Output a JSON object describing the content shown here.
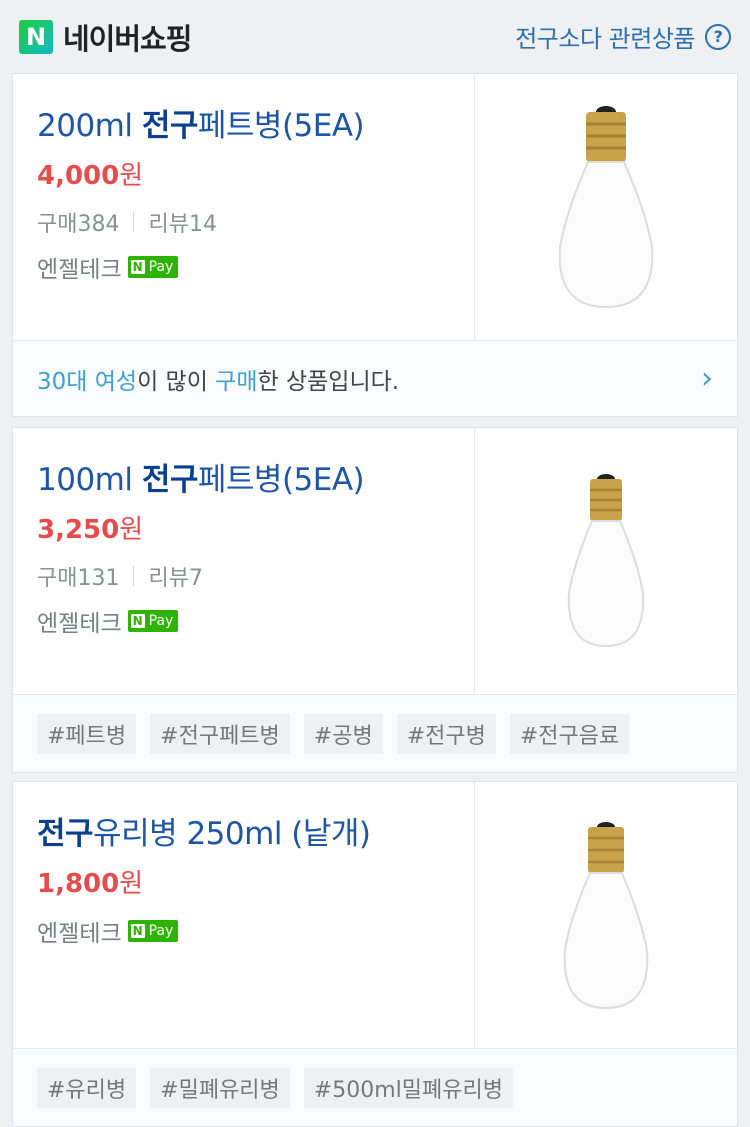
{
  "header": {
    "logo_letter": "N",
    "title": "네이버쇼핑",
    "related_link": "전구소다 관련상품",
    "help_symbol": "?"
  },
  "products": [
    {
      "title_pre": "200ml ",
      "title_bold": "전구",
      "title_post": "페트병(5EA)",
      "price": "4,000",
      "price_unit": "원",
      "purchases": "구매384",
      "reviews": "리뷰14",
      "seller": "엔젤테크",
      "npay_label": "Pay",
      "npay_n": "N",
      "note": {
        "part1": "30대 여성",
        "part2": "이 많이 ",
        "part3": "구매",
        "part4": "한 상품입니다."
      }
    },
    {
      "title_pre": "100ml ",
      "title_bold": "전구",
      "title_post": "페트병(5EA)",
      "price": "3,250",
      "price_unit": "원",
      "purchases": "구매131",
      "reviews": "리뷰7",
      "seller": "엔젤테크",
      "npay_label": "Pay",
      "npay_n": "N",
      "tags": [
        "#페트병",
        "#전구페트병",
        "#공병",
        "#전구병",
        "#전구음료"
      ]
    },
    {
      "title_pre": "",
      "title_bold": "전구",
      "title_post": "유리병 250ml (낱개)",
      "price": "1,800",
      "price_unit": "원",
      "seller": "엔젤테크",
      "npay_label": "Pay",
      "npay_n": "N",
      "tags": [
        "#유리병",
        "#밀폐유리병",
        "#500ml밀폐유리병"
      ]
    }
  ],
  "colors": {
    "brand_green": "#2db400",
    "link_blue": "#1d56a6",
    "price_red": "#e74c4c",
    "highlight_blue": "#3aa0d6"
  },
  "icons": {
    "chevron": "chevron-right-icon",
    "help": "help-circle-icon"
  }
}
